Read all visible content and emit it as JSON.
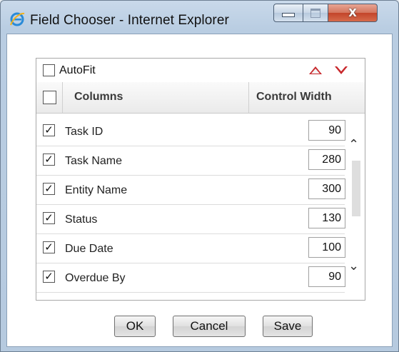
{
  "window": {
    "title": "Field Chooser - Internet Explorer",
    "icon": "internet-explorer-icon",
    "controls": {
      "minimize": "minimize-icon",
      "maximize": "maximize-icon",
      "close_glyph": "X"
    }
  },
  "autofit": {
    "label": "AutoFit",
    "checked": false
  },
  "header": {
    "select_all_checked": false,
    "columns_label": "Columns",
    "width_label": "Control Width"
  },
  "rows": [
    {
      "label": "Task ID",
      "checked": true,
      "width": "90"
    },
    {
      "label": "Task Name",
      "checked": true,
      "width": "280"
    },
    {
      "label": "Entity Name",
      "checked": true,
      "width": "300"
    },
    {
      "label": "Status",
      "checked": true,
      "width": "130"
    },
    {
      "label": "Due Date",
      "checked": true,
      "width": "100"
    },
    {
      "label": "Overdue By",
      "checked": true,
      "width": "90"
    }
  ],
  "buttons": {
    "ok": "OK",
    "cancel": "Cancel",
    "save": "Save"
  },
  "colors": {
    "arrow": "#c8272b",
    "close_button": "#c3452a"
  }
}
